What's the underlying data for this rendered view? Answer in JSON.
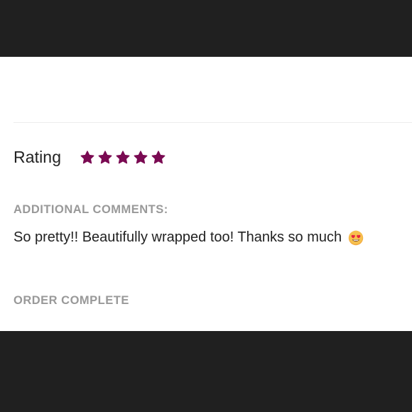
{
  "review": {
    "rating_label": "Rating",
    "rating_value": 5,
    "rating_max": 5,
    "star_color": "#7a0a52",
    "comments_label": "ADDITIONAL COMMENTS:",
    "comment_text": "So pretty!! Beautifully wrapped too! Thanks so much",
    "comment_emoji": "smiling-face-with-heart-eyes-icon",
    "status_label": "ORDER COMPLETE"
  }
}
